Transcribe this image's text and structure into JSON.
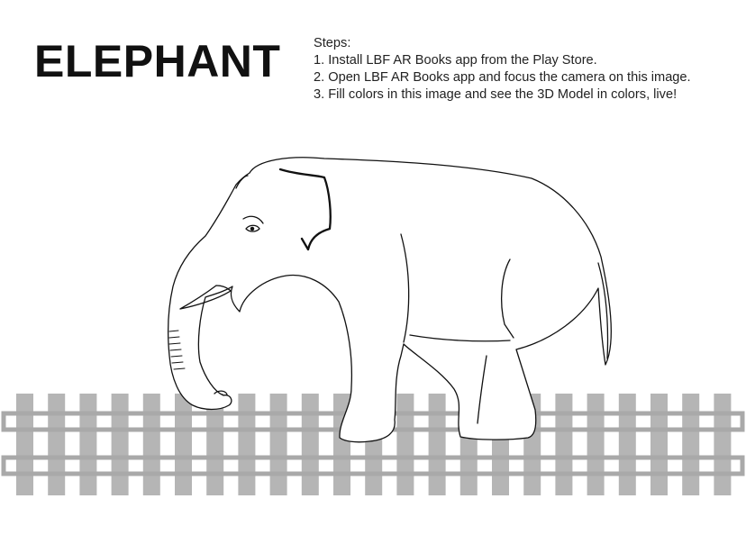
{
  "page": {
    "title": "ELEPHANT",
    "steps_heading": "Steps:",
    "steps": [
      "1. Install LBF AR Books app from the Play Store.",
      "2. Open LBF AR Books app and focus the camera on this image.",
      "3. Fill colors in this image and see the 3D Model in colors, live!"
    ]
  },
  "illustration": {
    "subject": "elephant-outline",
    "line_color": "#111111",
    "track_tie_color": "#b5b5b5",
    "track_rail_color": "#a9a9a9"
  }
}
